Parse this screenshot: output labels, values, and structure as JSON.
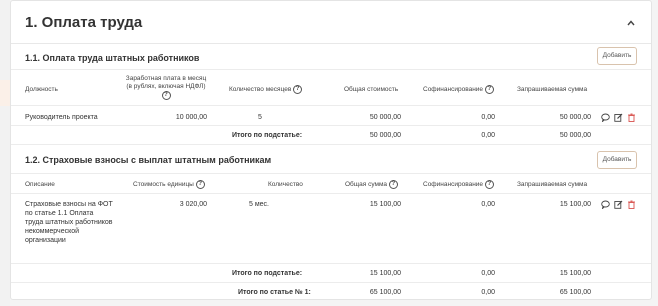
{
  "section": {
    "title": "1. Оплата труда"
  },
  "sub1": {
    "title": "1.1. Оплата труда штатных работников",
    "add_label": "Добавить",
    "headers": {
      "position": "Должность",
      "salary": "Заработная плата в месяц (в рублях, включая НДФЛ)",
      "months": "Количество месяцев",
      "total": "Общая стоимость",
      "cofinance": "Софинансирование",
      "requested": "Запрашиваемая сумма"
    },
    "row": {
      "position": "Руководитель проекта",
      "salary": "10 000,00",
      "months": "5",
      "total": "50 000,00",
      "cofinance": "0,00",
      "requested": "50 000,00"
    },
    "subtotal": {
      "label": "Итого по подстатье:",
      "total": "50 000,00",
      "cofinance": "0,00",
      "requested": "50 000,00"
    }
  },
  "sub2": {
    "title": "1.2. Страховые взносы с выплат штатным работникам",
    "add_label": "Добавить",
    "headers": {
      "description": "Описание",
      "unit_cost": "Стоимость единицы",
      "quantity": "Количество",
      "total": "Общая сумма",
      "cofinance": "Софинансирование",
      "requested": "Запрашиваемая сумма"
    },
    "row": {
      "description": "Страховые взносы на ФОТ по статье 1.1 Оплата труда штатных работников некоммерческой организации",
      "unit_cost": "3 020,00",
      "quantity": "5 мес.",
      "total": "15 100,00",
      "cofinance": "0,00",
      "requested": "15 100,00"
    },
    "subtotal": {
      "label": "Итого по подстатье:",
      "total": "15 100,00",
      "cofinance": "0,00",
      "requested": "15 100,00"
    },
    "article_total": {
      "label": "Итого по статье № 1:",
      "total": "65 100,00",
      "cofinance": "0,00",
      "requested": "65 100,00"
    }
  },
  "icons": {
    "help": "question-circle-icon",
    "comment": "comment-icon",
    "edit": "edit-icon",
    "delete": "trash-icon",
    "collapse": "chevron-up-icon"
  },
  "colors": {
    "delete_icon": "#d9534f",
    "add_border": "#d9c3ad"
  }
}
